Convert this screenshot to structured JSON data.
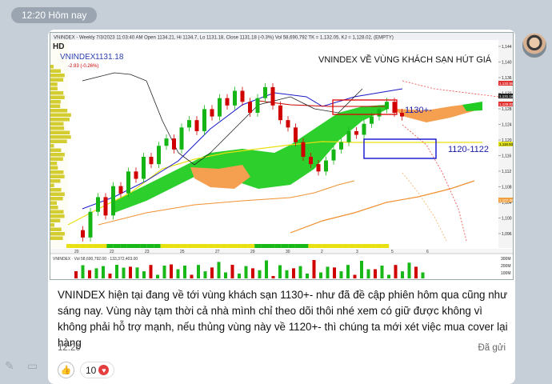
{
  "header": {
    "time_label": "12:20 Hôm nay"
  },
  "chart": {
    "hd_badge": "HD",
    "top_info": "VNINDEX - Weekly 7/3/2023 11:03:40 AM Open 1134.21, Hi 1134.7, Lo 1131.18, Close 1131.18 (-0.3%) Vol 58,690,792 TK = 1,132.05, KJ = 1,128.02, (EMPTY)",
    "index_name": "VNINDEX",
    "index_value": "1131.18",
    "index_change": "-2.93 (-0.26%)",
    "title": "VNINDEX VỀ VÙNG KHÁCH SẠN HÚT GIÁ",
    "label_1130": "1130+-",
    "label_1120": "1120-1122",
    "volume_label": "VNINDEX · Vol 58,690,792.00 · 133,372,403.00",
    "x_ticks": [
      "20",
      "22",
      "23",
      "25",
      "27",
      "29",
      "30",
      "2",
      "3",
      "5",
      "6"
    ],
    "y_ticks": [
      "1,144",
      "1,140",
      "1,136",
      "1,132",
      "1,128",
      "1,124",
      "1,120",
      "1,116",
      "1,112",
      "1,108",
      "1,104",
      "1,100",
      "1,096"
    ],
    "right_badges": [
      "1,132.55",
      "1,131.18",
      "1,128.02",
      "1,118.93",
      "1,107.36"
    ],
    "vol_ticks": [
      "300M",
      "200M",
      "100M"
    ],
    "colors": {
      "up": "#16b516",
      "down": "#d00000",
      "cloud_green": "#22cc22",
      "cloud_orange": "#f5a050",
      "kijun": "#1818c8",
      "tenkan": "#cc0000",
      "span_yellow": "#e8e010",
      "price_line": "#222222"
    }
  },
  "message": {
    "text": "VNINDEX hiện tại đang về tới vùng khách sạn 1130+- như đã đề cập phiên hôm qua cũng như sáng nay. Vùng này tạm thời cả nhà mình chỉ theo dõi thôi nhé xem có giữ được không vì không phải hỗ trợ mạnh, nếu thủng vùng này về 1120+- thì chúng ta mới xét việc mua cover lại hàng",
    "time": "12:20",
    "status": "Đã gửi",
    "reaction_count": "10"
  }
}
